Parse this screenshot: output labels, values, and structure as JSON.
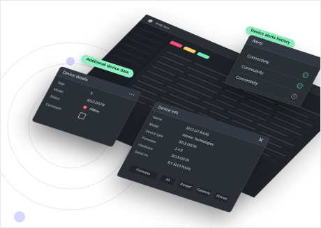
{
  "colors": {
    "orbit": "#b9b6f6",
    "orbitDot": "#d3d1ff",
    "callout": "#8cf0c0",
    "tabPink": "#ff4d7d",
    "tabYellow": "#ffd36b",
    "tabGreen": "#6ff0b2",
    "offline": "#ff6b6b"
  },
  "app": {
    "title": "Kelp Box"
  },
  "callouts": {
    "left": "Additional device data",
    "right": "Device alerts history"
  },
  "panels": {
    "left": {
      "title": "Device details",
      "fields": [
        {
          "k": "Tags",
          "v": "5"
        },
        {
          "k": "Model",
          "v": "3213-DSTR"
        },
        {
          "k": "Status",
          "v": "Offline"
        },
        {
          "k": "Constraint",
          "v": ""
        }
      ]
    },
    "right": {
      "title": "Alerts",
      "items": [
        {
          "text": "Connectivity",
          "icon": "check-icon",
          "tone": "green"
        },
        {
          "text": "Connectivity",
          "icon": "check-icon",
          "tone": "green"
        },
        {
          "text": "Connectivity",
          "icon": "info-icon",
          "tone": "neutral"
        }
      ]
    },
    "bottom": {
      "title": "Device info",
      "fields": [
        {
          "k": "Name",
          "v": "3212-DT-RXA5"
        },
        {
          "k": "Model",
          "v": "Alexion Technologies"
        },
        {
          "k": "Device type",
          "v": "3213-DSTR"
        },
        {
          "k": "Firmware",
          "v": "1.4.5"
        },
        {
          "k": "Hardware",
          "v": "3213-DSTR"
        },
        {
          "k": "Serial no.",
          "v": "DT-3213-RXA5"
        }
      ],
      "toolbar": [
        "Firmware",
        "All",
        "Restart",
        "Gateway",
        "Shared"
      ]
    }
  }
}
